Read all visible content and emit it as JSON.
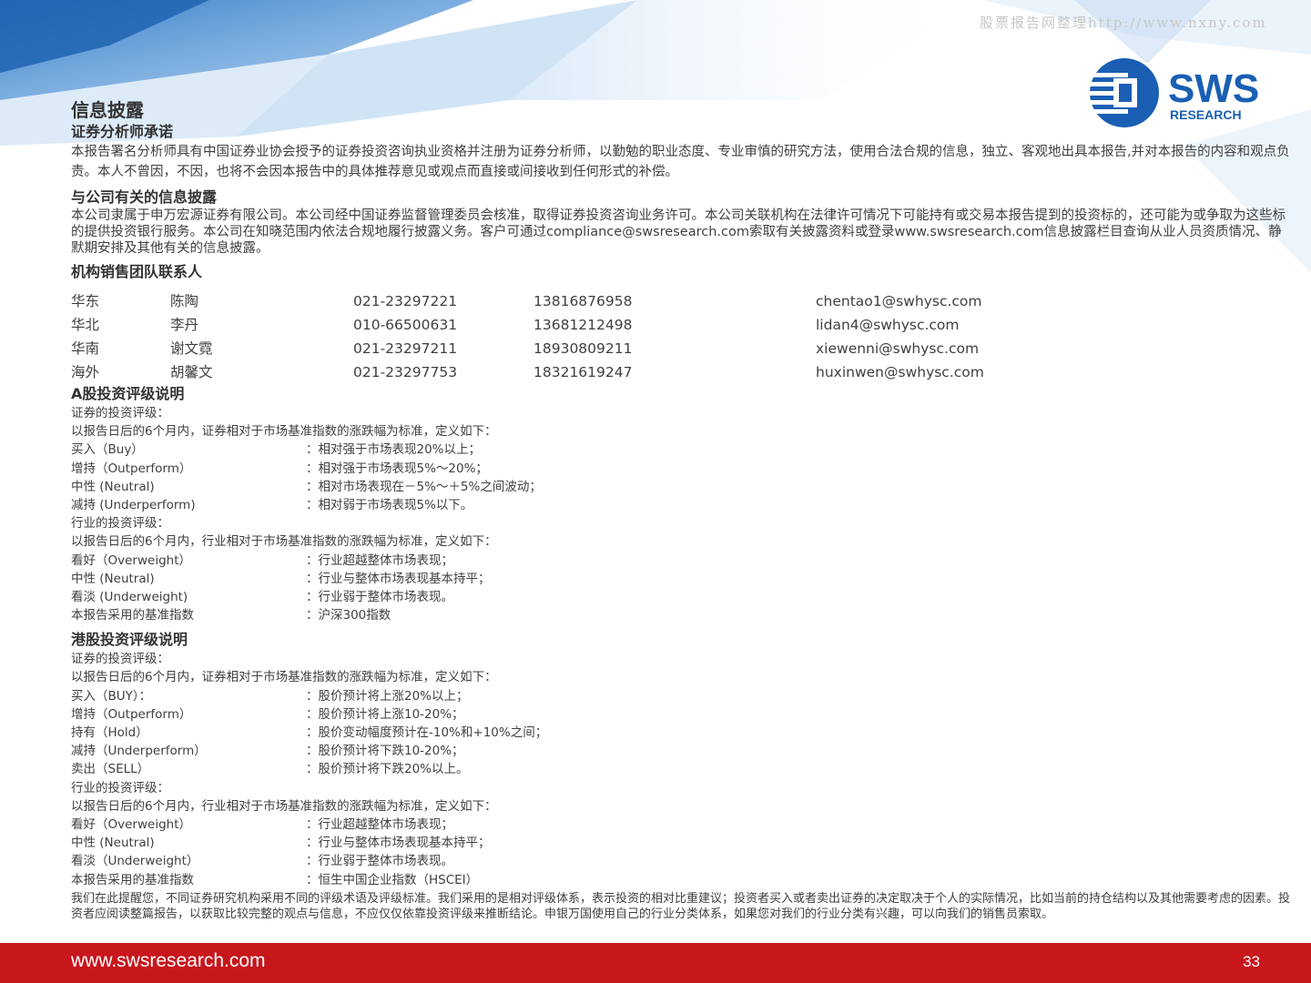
{
  "watermark": "股票报告网整理http://www.nxny.com",
  "logo": {
    "name": "SWS",
    "sub": "RESEARCH"
  },
  "title": "信息披露",
  "analyst_heading": "证券分析师承诺",
  "analyst_text": "本报告署名分析师具有中国证券业协会授予的证券投资咨询执业资格并注册为证券分析师，以勤勉的职业态度、专业审慎的研究方法，使用合法合规的信息，独立、客观地出具本报告,并对本报告的内容和观点负责。本人不曾因，不因，也将不会因本报告中的具体推荐意见或观点而直接或间接收到任何形式的补偿。",
  "company_heading": "与公司有关的信息披露",
  "company_text": "本公司隶属于申万宏源证券有限公司。本公司经中国证券监督管理委员会核准，取得证券投资咨询业务许可。本公司关联机构在法律许可情况下可能持有或交易本报告提到的投资标的，还可能为或争取为这些标的提供投资银行服务。本公司在知晓范围内依法合规地履行披露义务。客户可通过compliance@swsresearch.com索取有关披露资料或登录www.swsresearch.com信息披露栏目查询从业人员资质情况、静默期安排及其他有关的信息披露。",
  "sales_heading": "机构销售团队联系人",
  "contacts": [
    {
      "region": "华东",
      "name": "陈陶",
      "phone": "021-23297221",
      "mobile": "13816876958",
      "email": "chentao1@swhysc.com"
    },
    {
      "region": "华北",
      "name": "李丹",
      "phone": "010-66500631",
      "mobile": "13681212498",
      "email": "lidan4@swhysc.com"
    },
    {
      "region": "华南",
      "name": "谢文霓",
      "phone": "021-23297211",
      "mobile": "18930809211",
      "email": "xiewenni@swhysc.com"
    },
    {
      "region": "海外",
      "name": "胡馨文",
      "phone": "021-23297753",
      "mobile": "18321619247",
      "email": "huxinwen@swhysc.com"
    }
  ],
  "a_share": {
    "heading": "A股投资评级说明",
    "stock_label": "证券的投资评级：",
    "stock_def": "以报告日后的6个月内，证券相对于市场基准指数的涨跌幅为标准，定义如下：",
    "stock_ratings": [
      {
        "k": "买入（Buy）",
        "v": "：相对强于市场表现20%以上；"
      },
      {
        "k": "增持（Outperform）",
        "v": "：相对强于市场表现5%～20%；"
      },
      {
        "k": "中性 (Neutral)",
        "v": "：相对市场表现在－5%～＋5%之间波动；"
      },
      {
        "k": "减持 (Underperform)",
        "v": "：相对弱于市场表现5%以下。"
      }
    ],
    "industry_label": "行业的投资评级：",
    "industry_def": "以报告日后的6个月内，行业相对于市场基准指数的涨跌幅为标准，定义如下：",
    "industry_ratings": [
      {
        "k": "看好（Overweight）",
        "v": "：行业超越整体市场表现；"
      },
      {
        "k": "中性 (Neutral)",
        "v": "：行业与整体市场表现基本持平；"
      },
      {
        "k": "看淡 (Underweight)",
        "v": "：行业弱于整体市场表现。"
      },
      {
        "k": "本报告采用的基准指数",
        "v": "：沪深300指数"
      }
    ]
  },
  "hk_share": {
    "heading": "港股投资评级说明",
    "stock_label": "证券的投资评级：",
    "stock_def": "以报告日后的6个月内，证券相对于市场基准指数的涨跌幅为标准，定义如下：",
    "stock_ratings": [
      {
        "k": "买入（BUY）：",
        "v": "：股价预计将上涨20%以上；"
      },
      {
        "k": "增持（Outperform）",
        "v": "：股价预计将上涨10-20%；"
      },
      {
        "k": "持有（Hold）",
        "v": "：股价变动幅度预计在-10%和+10%之间；"
      },
      {
        "k": "减持（Underperform）",
        "v": "：股价预计将下跌10-20%；"
      },
      {
        "k": "卖出（SELL）",
        "v": "：股价预计将下跌20%以上。"
      }
    ],
    "industry_label": "行业的投资评级：",
    "industry_def": "以报告日后的6个月内，行业相对于市场基准指数的涨跌幅为标准，定义如下：",
    "industry_ratings": [
      {
        "k": "看好（Overweight）",
        "v": "：行业超越整体市场表现；"
      },
      {
        "k": "中性 (Neutral)",
        "v": "：行业与整体市场表现基本持平；"
      },
      {
        "k": "看淡（Underweight）",
        "v": "：行业弱于整体市场表现。"
      },
      {
        "k": "本报告采用的基准指数",
        "v": "：恒生中国企业指数（HSCEI）"
      }
    ]
  },
  "reminder": "我们在此提醒您，不同证券研究机构采用不同的评级术语及评级标准。我们采用的是相对评级体系，表示投资的相对比重建议；投资者买入或者卖出证券的决定取决于个人的实际情况，比如当前的持仓结构以及其他需要考虑的因素。投资者应阅读整篇报告，以获取比较完整的观点与信息，不应仅仅依靠投资评级来推断结论。申银万国使用自己的行业分类体系，如果您对我们的行业分类有兴趣，可以向我们的销售员索取。",
  "footer": {
    "url": "www.swsresearch.com",
    "page": "33"
  },
  "colors": {
    "brand_blue": "#1a5fb4",
    "footer_red": "#c8161d",
    "text": "#404040"
  }
}
